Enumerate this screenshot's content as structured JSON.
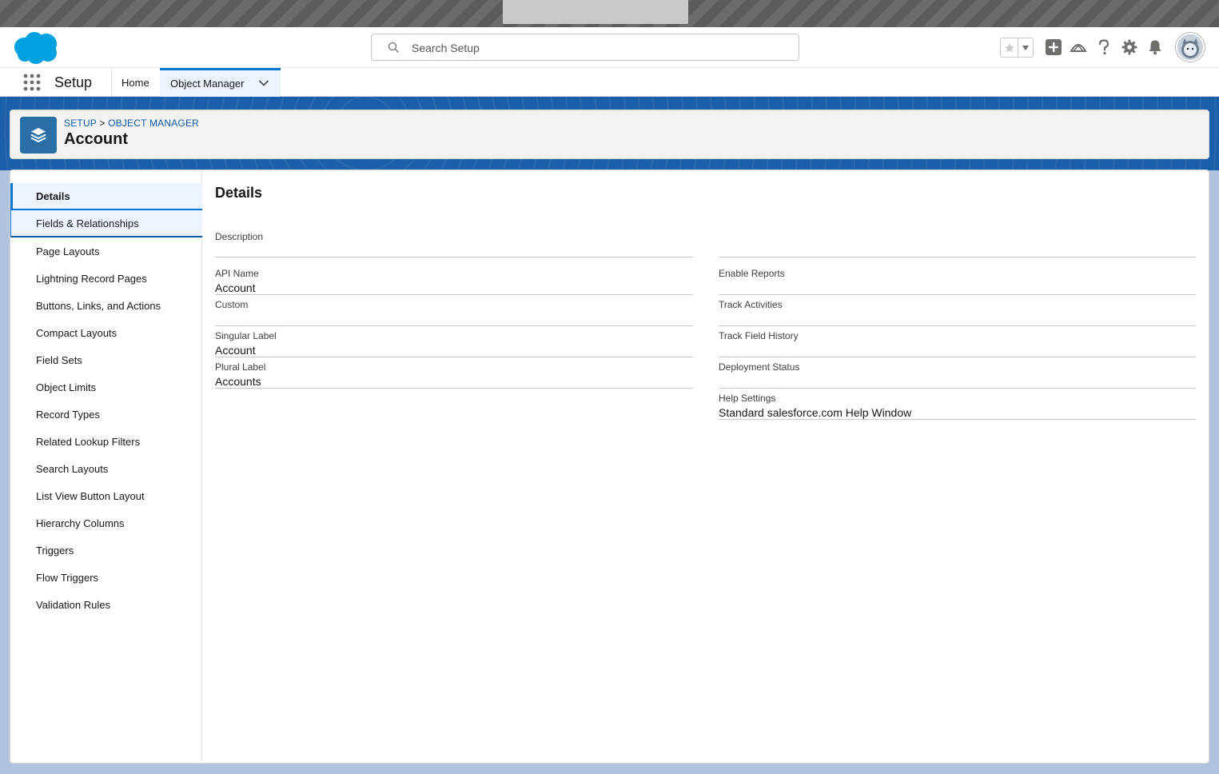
{
  "header": {
    "search_placeholder": "Search Setup"
  },
  "context_bar": {
    "app_name": "Setup",
    "tabs": [
      {
        "label": "Home"
      },
      {
        "label": "Object Manager"
      }
    ]
  },
  "object_header": {
    "breadcrumb_setup": "SETUP",
    "breadcrumb_sep": ">",
    "breadcrumb_object_manager": "OBJECT MANAGER",
    "title": "Account"
  },
  "side_nav": {
    "items": [
      {
        "label": "Details"
      },
      {
        "label": "Fields & Relationships"
      },
      {
        "label": "Page Layouts"
      },
      {
        "label": "Lightning Record Pages"
      },
      {
        "label": "Buttons, Links, and Actions"
      },
      {
        "label": "Compact Layouts"
      },
      {
        "label": "Field Sets"
      },
      {
        "label": "Object Limits"
      },
      {
        "label": "Record Types"
      },
      {
        "label": "Related Lookup Filters"
      },
      {
        "label": "Search Layouts"
      },
      {
        "label": "List View Button Layout"
      },
      {
        "label": "Hierarchy Columns"
      },
      {
        "label": "Triggers"
      },
      {
        "label": "Flow Triggers"
      },
      {
        "label": "Validation Rules"
      }
    ]
  },
  "details": {
    "title": "Details",
    "description": {
      "label": "Description",
      "value": ""
    },
    "left": [
      {
        "label": "API Name",
        "value": "Account"
      },
      {
        "label": "Custom",
        "value": ""
      },
      {
        "label": "Singular Label",
        "value": "Account"
      },
      {
        "label": "Plural Label",
        "value": "Accounts"
      }
    ],
    "right": [
      {
        "label": "Enable Reports",
        "value": ""
      },
      {
        "label": "Track Activities",
        "value": ""
      },
      {
        "label": "Track Field History",
        "value": ""
      },
      {
        "label": "Deployment Status",
        "value": ""
      },
      {
        "label": "Help Settings",
        "value": "Standard salesforce.com Help Window"
      }
    ]
  },
  "colors": {
    "brand_blue": "#0176d3",
    "link_blue": "#0b5cab",
    "object_icon": "#2b6fa7",
    "cloud_logo": "#00a1e0"
  }
}
